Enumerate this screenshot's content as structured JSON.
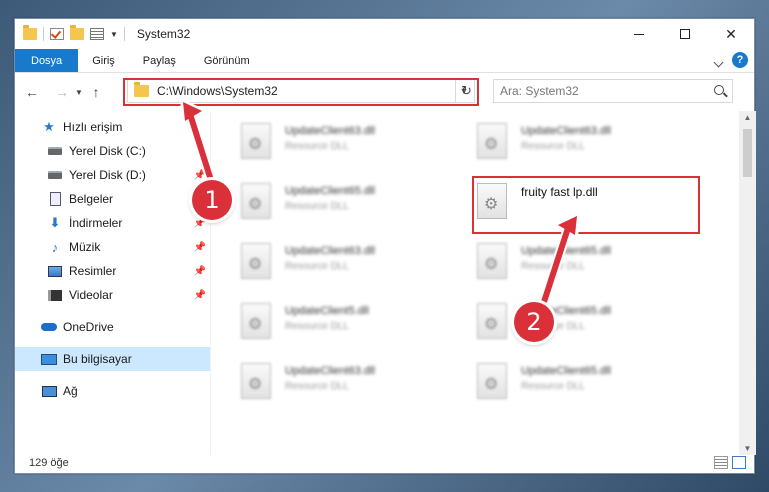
{
  "window": {
    "title": "System32"
  },
  "ribbon": {
    "tabs": [
      {
        "label": "Dosya",
        "active": true
      },
      {
        "label": "Giriş"
      },
      {
        "label": "Paylaş"
      },
      {
        "label": "Görünüm"
      }
    ]
  },
  "address": {
    "path": "C:\\Windows\\System32"
  },
  "search": {
    "placeholder": "Ara: System32"
  },
  "sidebar": {
    "quick_access": "Hızlı erişim",
    "items": [
      {
        "label": "Yerel Disk (C:)",
        "icon": "drive-icon"
      },
      {
        "label": "Yerel Disk (D:)",
        "icon": "drive-icon",
        "pinned": true
      },
      {
        "label": "Belgeler",
        "icon": "documents-icon",
        "pinned": true
      },
      {
        "label": "İndirmeler",
        "icon": "download-icon",
        "pinned": true
      },
      {
        "label": "Müzik",
        "icon": "music-icon",
        "pinned": true
      },
      {
        "label": "Resimler",
        "icon": "pictures-icon",
        "pinned": true
      },
      {
        "label": "Videolar",
        "icon": "videos-icon",
        "pinned": true
      }
    ],
    "onedrive": "OneDrive",
    "this_pc": "Bu bilgisayar",
    "network": "Ağ"
  },
  "files": [
    {
      "name": "UpdateClient63.dll",
      "type": "Resource DLL"
    },
    {
      "name": "UpdateClient63.dll",
      "type": "Resource DLL"
    },
    {
      "name": "UpdateClient65.dll",
      "type": "Resource DLL"
    },
    {
      "name": "fruity fast lp.dll",
      "type": ""
    },
    {
      "name": "UpdateClient63.dll",
      "type": "Resource DLL"
    },
    {
      "name": "UpdateClient65.dll",
      "type": "Resource DLL"
    },
    {
      "name": "UpdateClient5.dll",
      "type": "Resource DLL"
    },
    {
      "name": "UpdateClient65.dll",
      "type": "Resource DLL"
    },
    {
      "name": "UpdateClient63.dll",
      "type": "Resource DLL"
    },
    {
      "name": "UpdateClient65.dll",
      "type": "Resource DLL"
    }
  ],
  "status": {
    "count": "129 öğe"
  },
  "annotations": {
    "step1": "1",
    "step2": "2"
  },
  "colors": {
    "accent": "#1979ca",
    "highlight": "#d9303a",
    "selected": "#cce8ff"
  }
}
